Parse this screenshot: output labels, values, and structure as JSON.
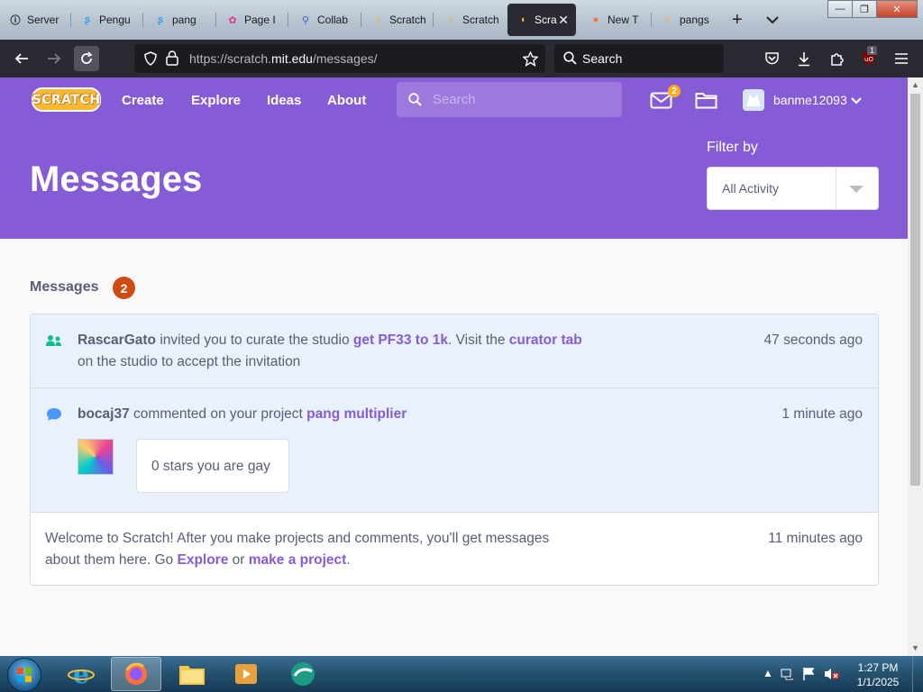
{
  "browser": {
    "tabs": [
      {
        "label": "Server",
        "icon": "info-icon",
        "fav_color": "#1a1a1a"
      },
      {
        "label": "Pengu",
        "icon": "scratch-addons-icon",
        "fav_color": "#2a9df4"
      },
      {
        "label": "pang",
        "icon": "scratch-addons-icon",
        "fav_color": "#2a9df4"
      },
      {
        "label": "Page I",
        "icon": "gear-icon",
        "fav_color": "#e0338f"
      },
      {
        "label": "Collab",
        "icon": "search-icon",
        "fav_color": "#3d5ae0"
      },
      {
        "label": "Scratch",
        "icon": "scratch-cat-icon",
        "fav_color": "#f8b830"
      },
      {
        "label": "Scratch",
        "icon": "scratch-cat-icon",
        "fav_color": "#f8b830"
      },
      {
        "label": "Scra",
        "icon": "scratch-cat-icon",
        "fav_color": "#f8b830",
        "active": true
      },
      {
        "label": "New T",
        "icon": "firefox-icon",
        "fav_color": "#ff7139"
      },
      {
        "label": "pangs",
        "icon": "scratch-cat-icon",
        "fav_color": "#f8b830"
      }
    ],
    "new_tab": "+",
    "url_host": "https://scratch.",
    "url_domain": "mit.edu",
    "url_path": "/messages/",
    "search_placeholder": "Search",
    "extension_badge": "1"
  },
  "site": {
    "nav": {
      "create": "Create",
      "explore": "Explore",
      "ideas": "Ideas",
      "about": "About",
      "search_placeholder": "Search",
      "message_count": "2",
      "username": "banme12093",
      "logo_text": "SCRATCH"
    },
    "banner": {
      "title": "Messages",
      "filter_label": "Filter by",
      "filter_value": "All Activity"
    },
    "messages_section": {
      "title": "Messages",
      "count": "2"
    },
    "messages": [
      {
        "user": "RascarGato",
        "text1": " invited you to curate the studio ",
        "studio": "get PF33 to 1k",
        "text2": ". Visit the ",
        "link": "curator tab",
        "text3": "on the studio to accept the invitation",
        "time": "47 seconds ago"
      },
      {
        "user": "bocaj37",
        "text1": " commented on your project ",
        "project": "pang multiplier",
        "comment": "0 stars you are gay",
        "time": "1 minute ago"
      },
      {
        "text1": "Welcome to Scratch! After you make projects and comments, you'll get messages",
        "text2": "about them here. Go ",
        "link1": "Explore",
        "text3": " or ",
        "link2": "make a project",
        "text4": ".",
        "time": "11 minutes ago"
      }
    ]
  },
  "taskbar": {
    "time": "1:27 PM",
    "date": "1/1/2025"
  },
  "colors": {
    "scratch_purple": "#855cd6",
    "badge_orange": "#cf4b12",
    "message_badge": "#ffab1a",
    "unread_bg": "#e9f1fc"
  }
}
